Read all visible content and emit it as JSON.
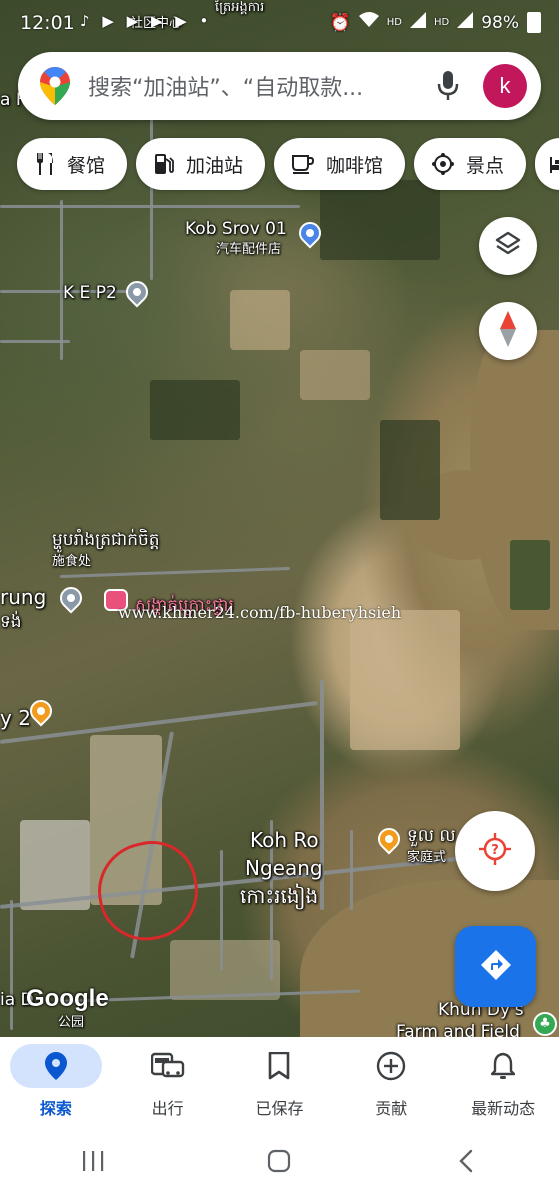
{
  "status_bar": {
    "time": "12:01",
    "network": "HD",
    "battery": "98%"
  },
  "search": {
    "placeholder": "搜索“加油站”、“自动取款...",
    "avatar_letter": "k"
  },
  "chips": [
    {
      "label": "餐馆",
      "icon": "restaurant-icon"
    },
    {
      "label": "加油站",
      "icon": "gas-station-icon"
    },
    {
      "label": "咖啡馆",
      "icon": "coffee-icon"
    },
    {
      "label": "景点",
      "icon": "attraction-icon"
    }
  ],
  "map": {
    "labels": {
      "kob_srov": "Kob Srov 01",
      "kob_srov_sub": "汽车配件店",
      "kep2": "K E P2",
      "khmer_label_1": "ម្ហូបរាំងត្រជាក់ចិត្ត",
      "khmer_label_1_sub": "施食处",
      "rung": "rung",
      "rung_khmer": "ទង់",
      "guesthouse_khmer": "សង្កាត់ក្រោះផ្ទារ",
      "y2": "y 2",
      "koh_ro": "Koh Ro",
      "ngeang": "Ngeang",
      "koh_khmer": "កោះរងៀង",
      "restaurant_khmer": "ទួល ល",
      "restaurant_sub": "家庭式",
      "khun_dys": "Khun Dy's",
      "farm": "Farm and Field",
      "park": "公园",
      "a_h": "a H",
      "top_khmer": "ត្រែអង្គការ",
      "top_sub": "社区中心",
      "bottom_left": "ia D"
    },
    "watermark": "www.khmer24.com/fb-huberyhsieh",
    "attribution": "Google"
  },
  "bottom_nav": [
    {
      "label": "探索",
      "icon": "location-pin-icon",
      "active": true
    },
    {
      "label": "出行",
      "icon": "commute-icon",
      "active": false
    },
    {
      "label": "已保存",
      "icon": "bookmark-icon",
      "active": false
    },
    {
      "label": "贡献",
      "icon": "add-circle-icon",
      "active": false
    },
    {
      "label": "最新动态",
      "icon": "bell-icon",
      "active": false
    }
  ],
  "colors": {
    "accent": "#1a73e8",
    "active_nav_bg": "#d3e3fd",
    "avatar_bg": "#c2185b",
    "highlight_circle": "#d9282a"
  }
}
